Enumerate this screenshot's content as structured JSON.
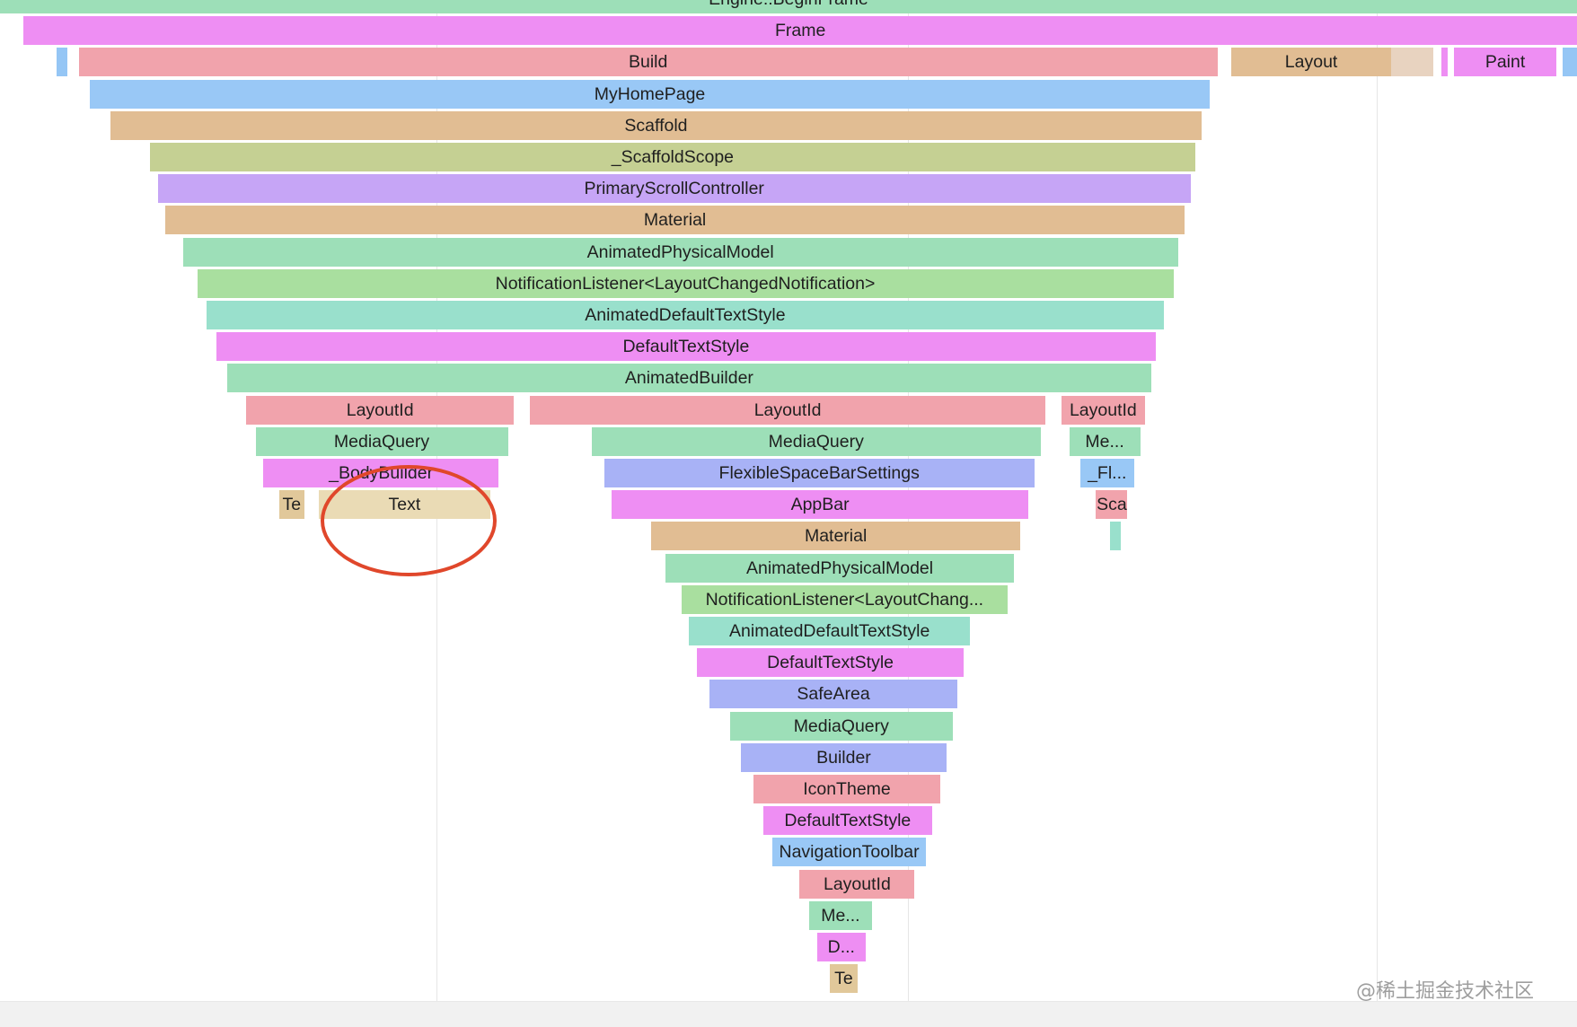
{
  "chart_data": {
    "type": "flame",
    "frames": [
      {
        "label": "Engine::BeginFrame",
        "color": "#9ddfb8",
        "depth": 0,
        "start": 0.0,
        "end": 100.0
      },
      {
        "label": "Frame",
        "color": "#ee8ef3",
        "depth": 1,
        "start": 1.5,
        "end": 100.0
      },
      {
        "label": "",
        "color": "#95c6f5",
        "depth": 2,
        "start": 3.6,
        "end": 4.3
      },
      {
        "label": "Build",
        "color": "#f1a3ac",
        "depth": 2,
        "start": 5.0,
        "end": 77.2
      },
      {
        "label": "Layout",
        "color": "#e1bd93",
        "depth": 2,
        "start": 78.1,
        "end": 88.2
      },
      {
        "label": "",
        "color": "#e8d3c0",
        "depth": 2,
        "start": 88.2,
        "end": 90.9
      },
      {
        "label": "",
        "color": "#ee8ef3",
        "depth": 2,
        "start": 91.4,
        "end": 91.8
      },
      {
        "label": "Paint",
        "color": "#ee8ef3",
        "depth": 2,
        "start": 92.2,
        "end": 98.7
      },
      {
        "label": "",
        "color": "#95c6f5",
        "depth": 2,
        "start": 99.1,
        "end": 100.0
      },
      {
        "label": "MyHomePage",
        "color": "#99c8f6",
        "depth": 3,
        "start": 5.7,
        "end": 76.7
      },
      {
        "label": "Scaffold",
        "color": "#e1bd93",
        "depth": 4,
        "start": 7.0,
        "end": 76.2
      },
      {
        "label": "_ScaffoldScope",
        "color": "#c5d093",
        "depth": 5,
        "start": 9.5,
        "end": 75.8
      },
      {
        "label": "PrimaryScrollController",
        "color": "#c6a5f6",
        "depth": 6,
        "start": 10.0,
        "end": 75.5
      },
      {
        "label": "Material",
        "color": "#e1bd93",
        "depth": 7,
        "start": 10.5,
        "end": 75.1
      },
      {
        "label": "AnimatedPhysicalModel",
        "color": "#9ddfb8",
        "depth": 8,
        "start": 11.6,
        "end": 74.7
      },
      {
        "label": "NotificationListener<LayoutChangedNotification>",
        "color": "#a9df9f",
        "depth": 9,
        "start": 12.5,
        "end": 74.4
      },
      {
        "label": "AnimatedDefaultTextStyle",
        "color": "#99e0cc",
        "depth": 10,
        "start": 13.1,
        "end": 73.8
      },
      {
        "label": "DefaultTextStyle",
        "color": "#ee8ef3",
        "depth": 11,
        "start": 13.7,
        "end": 73.3
      },
      {
        "label": "AnimatedBuilder",
        "color": "#9ddfb8",
        "depth": 12,
        "start": 14.4,
        "end": 73.0
      },
      {
        "label": "LayoutId",
        "color": "#f1a3ac",
        "depth": 13,
        "start": 15.6,
        "end": 32.6
      },
      {
        "label": "LayoutId",
        "color": "#f1a3ac",
        "depth": 13,
        "start": 33.6,
        "end": 66.3
      },
      {
        "label": "LayoutId",
        "color": "#f1a3ac",
        "depth": 13,
        "start": 67.3,
        "end": 72.6
      },
      {
        "label": "MediaQuery",
        "color": "#9ddfb8",
        "depth": 14,
        "start": 16.2,
        "end": 32.2
      },
      {
        "label": "MediaQuery",
        "color": "#9ddfb8",
        "depth": 14,
        "start": 37.5,
        "end": 66.0
      },
      {
        "label": "Me...",
        "color": "#9ddfb8",
        "depth": 14,
        "start": 67.8,
        "end": 72.3
      },
      {
        "label": "_BodyBuilder",
        "color": "#ee8ef3",
        "depth": 15,
        "start": 16.7,
        "end": 31.6
      },
      {
        "label": "FlexibleSpaceBarSettings",
        "color": "#a8b2f6",
        "depth": 15,
        "start": 38.3,
        "end": 65.6
      },
      {
        "label": "_Fl...",
        "color": "#99c8f6",
        "depth": 15,
        "start": 68.5,
        "end": 71.9
      },
      {
        "label": "Te",
        "color": "#e1c89a",
        "depth": 16,
        "start": 17.7,
        "end": 19.3
      },
      {
        "label": "Text",
        "color": "#eadbb5",
        "depth": 16,
        "start": 20.2,
        "end": 31.1
      },
      {
        "label": "AppBar",
        "color": "#ee8ef3",
        "depth": 16,
        "start": 38.8,
        "end": 65.2
      },
      {
        "label": "Sca",
        "color": "#f1a3ac",
        "depth": 16,
        "start": 69.5,
        "end": 71.5
      },
      {
        "label": "Material",
        "color": "#e1bd93",
        "depth": 17,
        "start": 41.3,
        "end": 64.7
      },
      {
        "label": "",
        "color": "#99e0cc",
        "depth": 17,
        "start": 70.4,
        "end": 71.1
      },
      {
        "label": "AnimatedPhysicalModel",
        "color": "#9ddfb8",
        "depth": 18,
        "start": 42.2,
        "end": 64.3
      },
      {
        "label": "NotificationListener<LayoutChang...",
        "color": "#a9df9f",
        "depth": 19,
        "start": 43.2,
        "end": 63.9
      },
      {
        "label": "AnimatedDefaultTextStyle",
        "color": "#99e0cc",
        "depth": 20,
        "start": 43.7,
        "end": 61.5
      },
      {
        "label": "DefaultTextStyle",
        "color": "#ee8ef3",
        "depth": 21,
        "start": 44.2,
        "end": 61.1
      },
      {
        "label": "SafeArea",
        "color": "#a8b2f6",
        "depth": 22,
        "start": 45.0,
        "end": 60.7
      },
      {
        "label": "MediaQuery",
        "color": "#9ddfb8",
        "depth": 23,
        "start": 46.3,
        "end": 60.4
      },
      {
        "label": "Builder",
        "color": "#a8b2f6",
        "depth": 24,
        "start": 47.0,
        "end": 60.0
      },
      {
        "label": "IconTheme",
        "color": "#f1a3ac",
        "depth": 25,
        "start": 47.8,
        "end": 59.6
      },
      {
        "label": "DefaultTextStyle",
        "color": "#ee8ef3",
        "depth": 26,
        "start": 48.4,
        "end": 59.1
      },
      {
        "label": "NavigationToolbar",
        "color": "#99c8f6",
        "depth": 27,
        "start": 49.0,
        "end": 58.7
      },
      {
        "label": "LayoutId",
        "color": "#f1a3ac",
        "depth": 28,
        "start": 50.7,
        "end": 58.0
      },
      {
        "label": "Me...",
        "color": "#9ddfb8",
        "depth": 29,
        "start": 51.3,
        "end": 55.3
      },
      {
        "label": "D...",
        "color": "#ee8ef3",
        "depth": 30,
        "start": 51.8,
        "end": 54.9
      },
      {
        "label": "Te",
        "color": "#e1c89a",
        "depth": 31,
        "start": 52.6,
        "end": 54.4
      }
    ],
    "gridlines": [
      27.7,
      57.6,
      87.3
    ],
    "highlight": {
      "target": "Text",
      "color": "#e0472b"
    }
  },
  "watermark": "@稀土掘金技术社区"
}
